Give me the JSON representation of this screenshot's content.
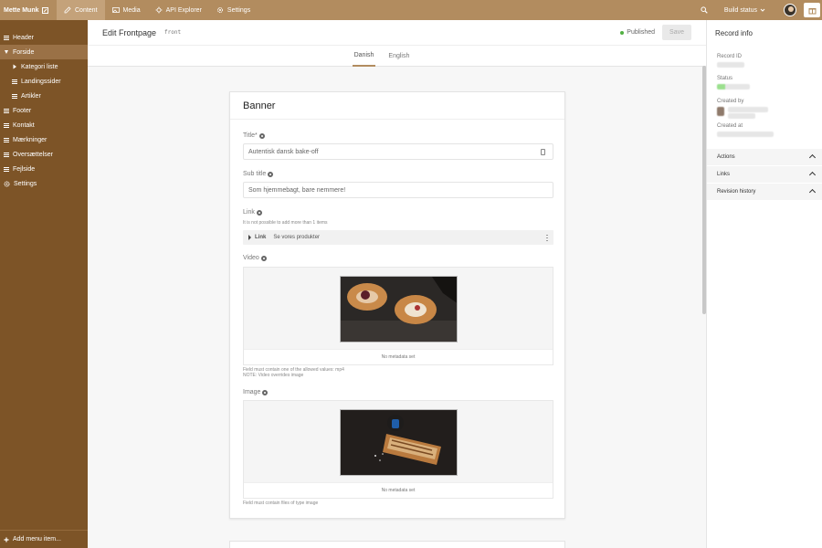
{
  "topbar": {
    "user": "Mette Munk",
    "nav": [
      {
        "label": "Content",
        "icon": "pencil-icon",
        "active": true
      },
      {
        "label": "Media",
        "icon": "image-icon",
        "active": false
      },
      {
        "label": "API Explorer",
        "icon": "api-icon",
        "active": false
      },
      {
        "label": "Settings",
        "icon": "gear-icon",
        "active": false
      }
    ],
    "build_status": "Build status"
  },
  "sidebar": {
    "items": [
      {
        "label": "Header",
        "icon": "lines-icon",
        "level": 0
      },
      {
        "label": "Forside",
        "icon": "expand-icon",
        "level": 0,
        "active": true
      },
      {
        "label": "Kategori liste",
        "icon": "triangle-icon",
        "level": 1
      },
      {
        "label": "Landingssider",
        "icon": "lines-icon",
        "level": 1
      },
      {
        "label": "Artikler",
        "icon": "lines-icon",
        "level": 1
      },
      {
        "label": "Footer",
        "icon": "lines-icon",
        "level": 0
      },
      {
        "label": "Kontakt",
        "icon": "lines-icon",
        "level": 0
      },
      {
        "label": "Mærkninger",
        "icon": "lines-icon",
        "level": 0
      },
      {
        "label": "Oversættelser",
        "icon": "lines-icon",
        "level": 0
      },
      {
        "label": "Fejlside",
        "icon": "lines-icon",
        "level": 0
      },
      {
        "label": "Settings",
        "icon": "gear-icon",
        "level": 0
      }
    ],
    "add_menu": "Add menu item..."
  },
  "editor": {
    "title": "Edit Frontpage",
    "key": "front",
    "status": "Published",
    "save_label": "Save",
    "tabs": [
      {
        "label": "Danish",
        "active": true
      },
      {
        "label": "English",
        "active": false
      }
    ]
  },
  "banner": {
    "title": "Banner",
    "title_label": "Title*",
    "title_value": "Autentisk dansk bake-off",
    "subtitle_label": "Sub title",
    "subtitle_value": "Som hjemmebagt, bare nemmere!",
    "link_label": "Link",
    "link_hint": "It is not possible to add more than 1 items",
    "link_type": "Link",
    "link_value": "Se vores produkter",
    "video_label": "Video",
    "video_meta": "No metadata set",
    "video_hint1": "Field must contain one of the allowed values: mp4",
    "video_hint2": "NOTE: Video overrides image",
    "image_label": "Image",
    "image_meta": "No metadata set",
    "image_hint": "Field must contain files of type image"
  },
  "record": {
    "title": "Record info",
    "labels": [
      "Record ID",
      "Status",
      "Created by",
      "Created at"
    ],
    "sections": [
      "Actions",
      "Links",
      "Revision history"
    ]
  },
  "colors": {
    "topbar": "#b28c5f",
    "sidebar": "#7d5427",
    "accent": "#b28c5f",
    "published": "#52b043"
  }
}
